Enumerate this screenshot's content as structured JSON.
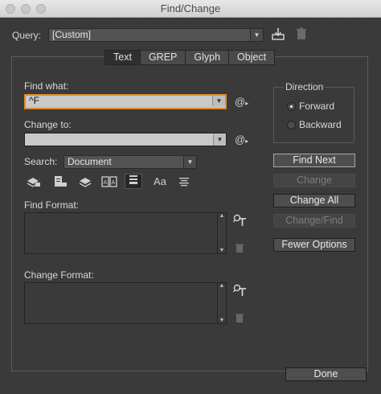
{
  "window": {
    "title": "Find/Change"
  },
  "query": {
    "label": "Query:",
    "value": "[Custom]"
  },
  "tabs": [
    {
      "label": "Text"
    },
    {
      "label": "GREP"
    },
    {
      "label": "Glyph"
    },
    {
      "label": "Object"
    }
  ],
  "find": {
    "label": "Find what:",
    "value": "^F"
  },
  "change": {
    "label": "Change to:",
    "value": ""
  },
  "search": {
    "label": "Search:",
    "value": "Document"
  },
  "find_format": {
    "label": "Find Format:"
  },
  "change_format": {
    "label": "Change Format:"
  },
  "direction": {
    "title": "Direction",
    "options": [
      {
        "label": "Forward",
        "selected": true
      },
      {
        "label": "Backward",
        "selected": false
      }
    ]
  },
  "buttons": {
    "find_next": "Find Next",
    "change": "Change",
    "change_all": "Change All",
    "change_find": "Change/Find",
    "fewer_options": "Fewer Options",
    "done": "Done"
  },
  "special_char_symbol": "@",
  "case_symbol": "Aa",
  "colors": {
    "background": "#3a3a3a",
    "focus": "#e08a2c",
    "field_light": "#c9c9c9"
  }
}
